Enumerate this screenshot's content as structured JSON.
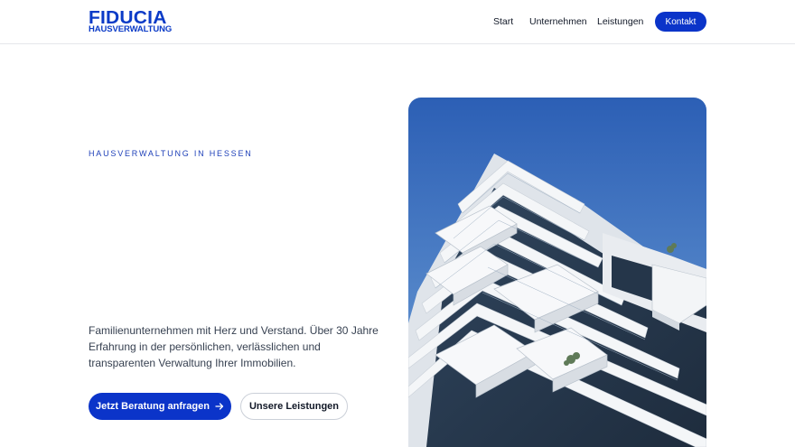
{
  "logo": {
    "main": "FIDUCIA",
    "sub": "HAUSVERWALTUNG"
  },
  "nav": {
    "items": [
      {
        "label": "Start"
      },
      {
        "label": "Unternehmen"
      },
      {
        "label": "Leistungen"
      }
    ],
    "cta_label": "Kontakt"
  },
  "hero": {
    "eyebrow": "HAUSVERWALTUNG IN HESSEN",
    "description": "Familienunternehmen mit Herz und Verstand. Über 30 Jahre Erfahrung in der persönlichen, verlässlichen und transparenten Verwaltung Ihrer Immobilien.",
    "primary_button": "Jetzt Beratung anfragen",
    "secondary_button": "Unsere Leistungen"
  },
  "colors": {
    "brand_blue": "#0b34c9",
    "sky_top": "#2f64b8",
    "sky_bottom": "#7fa6d8",
    "building": "#eef1f5"
  },
  "icons": {
    "primary_button_icon": "arrow-right-icon"
  }
}
